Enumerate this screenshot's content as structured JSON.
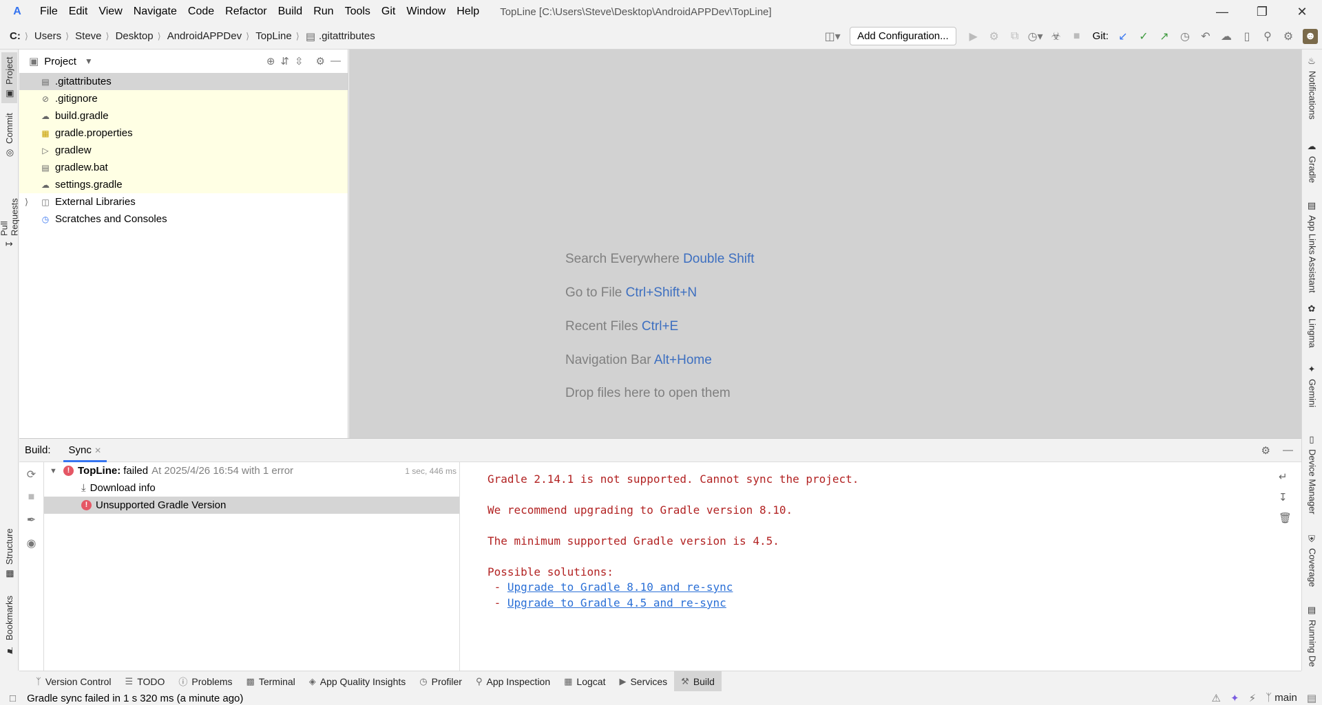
{
  "window": {
    "title": "TopLine [C:\\Users\\Steve\\Desktop\\AndroidAPPDev\\TopLine]"
  },
  "menu": [
    "File",
    "Edit",
    "View",
    "Navigate",
    "Code",
    "Refactor",
    "Build",
    "Run",
    "Tools",
    "Git",
    "Window",
    "Help"
  ],
  "breadcrumb": [
    "C:",
    "Users",
    "Steve",
    "Desktop",
    "AndroidAPPDev",
    "TopLine",
    ".gitattributes"
  ],
  "toolbar": {
    "add_config": "Add Configuration...",
    "git_label": "Git:"
  },
  "left_tabs": [
    "Project",
    "Commit",
    "Pull Requests",
    "Structure",
    "Bookmarks"
  ],
  "right_tabs": [
    "Notifications",
    "Gradle",
    "App Links Assistant",
    "Lingma",
    "Gemini",
    "Device Manager",
    "Coverage",
    "Running De"
  ],
  "project": {
    "header": "Project",
    "files": [
      ".gitattributes",
      ".gitignore",
      "build.gradle",
      "gradle.properties",
      "gradlew",
      "gradlew.bat",
      "settings.gradle"
    ],
    "external": "External Libraries",
    "scratches": "Scratches and Consoles"
  },
  "editor_hints": [
    {
      "text": "Search Everywhere",
      "key": "Double Shift"
    },
    {
      "text": "Go to File",
      "key": "Ctrl+Shift+N"
    },
    {
      "text": "Recent Files",
      "key": "Ctrl+E"
    },
    {
      "text": "Navigation Bar",
      "key": "Alt+Home"
    },
    {
      "text": "Drop files here to open them",
      "key": ""
    }
  ],
  "build": {
    "label": "Build:",
    "tab": "Sync",
    "root_name": "TopLine:",
    "root_status": "failed",
    "root_detail": "At 2025/4/26 16:54 with 1 error",
    "root_time": "1 sec, 446 ms",
    "child1": "Download info",
    "child2": "Unsupported Gradle Version",
    "console": {
      "l1": "Gradle 2.14.1 is not supported. Cannot sync the project.",
      "l2": "We recommend upgrading to Gradle version 8.10.",
      "l3": "The minimum supported Gradle version is 4.5.",
      "l4": "Possible solutions:",
      "l5_prefix": " - ",
      "link1": "Upgrade to Gradle 8.10 and re-sync",
      "link2": "Upgrade to Gradle 4.5 and re-sync"
    }
  },
  "bottom_tabs": [
    "Version Control",
    "TODO",
    "Problems",
    "Terminal",
    "App Quality Insights",
    "Profiler",
    "App Inspection",
    "Logcat",
    "Services",
    "Build"
  ],
  "status": {
    "message": "Gradle sync failed in 1 s 320 ms (a minute ago)",
    "branch": "main"
  }
}
